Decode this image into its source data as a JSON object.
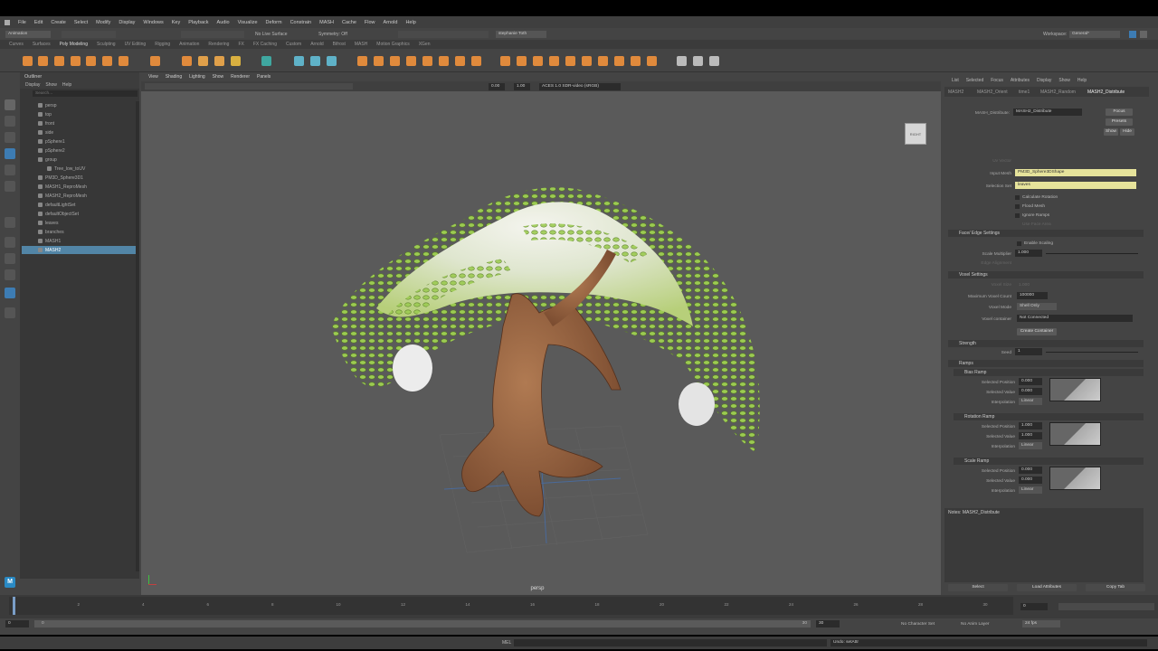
{
  "menus": [
    "File",
    "Edit",
    "Create",
    "Select",
    "Modify",
    "Display",
    "Windows",
    "Key",
    "Playback",
    "Audio",
    "Visualize",
    "Deform",
    "Constrain",
    "MASH",
    "Cache",
    "Flow",
    "Arnold",
    "Help"
  ],
  "status": {
    "mode": "Animation",
    "live_surface": "No Live Surface",
    "symmetry": "Symmetry: Off",
    "user": "stephanie Toth",
    "workspace_label": "Workspace:",
    "workspace": "General*"
  },
  "shelf_tabs": [
    "Curves",
    "Surfaces",
    "Poly Modeling",
    "Sculpting",
    "UV Editing",
    "Rigging",
    "Animation",
    "Rendering",
    "FX",
    "FX Caching",
    "Custom",
    "Arnold",
    "Bifrost",
    "MASH",
    "Motion Graphics",
    "XGen"
  ],
  "outliner": {
    "title": "Outliner",
    "menu": [
      "Display",
      "Show",
      "Help"
    ],
    "search_placeholder": "Search...",
    "items": [
      {
        "label": "persp",
        "depth": 1,
        "sel": false
      },
      {
        "label": "top",
        "depth": 1,
        "sel": false
      },
      {
        "label": "front",
        "depth": 1,
        "sel": false
      },
      {
        "label": "side",
        "depth": 1,
        "sel": false
      },
      {
        "label": "pSphere1",
        "depth": 1,
        "sel": false
      },
      {
        "label": "pSphere2",
        "depth": 1,
        "sel": false
      },
      {
        "label": "group",
        "depth": 1,
        "sel": false
      },
      {
        "label": "Tree_low_toUV",
        "depth": 2,
        "sel": false
      },
      {
        "label": "PM3D_Sphere3D1",
        "depth": 1,
        "sel": false
      },
      {
        "label": "MASH1_ReproMesh",
        "depth": 1,
        "sel": false
      },
      {
        "label": "MASH2_ReproMesh",
        "depth": 1,
        "sel": false
      },
      {
        "label": "defaultLightSet",
        "depth": 1,
        "sel": false
      },
      {
        "label": "defaultObjectSet",
        "depth": 1,
        "sel": false
      },
      {
        "label": "leaves",
        "depth": 1,
        "sel": false
      },
      {
        "label": "branches",
        "depth": 1,
        "sel": false
      },
      {
        "label": "MASH1",
        "depth": 1,
        "sel": false
      },
      {
        "label": "MASH2",
        "depth": 1,
        "sel": true
      }
    ]
  },
  "viewport": {
    "menu": [
      "View",
      "Shading",
      "Lighting",
      "Show",
      "Renderer",
      "Panels"
    ],
    "num1": "0.00",
    "num2": "1.00",
    "colorspace": "ACES 1.0 SDR-video (sRGB)",
    "camera": "persp",
    "cube_label": "RIGHT"
  },
  "attr": {
    "menu": [
      "List",
      "Selected",
      "Focus",
      "Attributes",
      "Display",
      "Show",
      "Help"
    ],
    "tabs": [
      "MASH2",
      "MASH2_Orient",
      "time1",
      "MASH2_Random",
      "MASH2_Distribute"
    ],
    "node_label": "MASH_Distribute:",
    "node_value": "MASH2_Distribute",
    "focus": "Focus",
    "presets": "Presets",
    "show": "Show",
    "hide": "Hide",
    "input_mesh_label": "Input Mesh",
    "input_mesh": "PM3D_Sphere3DShape",
    "selection_set_label": "Selection Set",
    "selection_set": "leaves",
    "uv_vector_label": "Uv Vector",
    "calc_rotation": "Calculate Rotation",
    "flood_mesh": "Flood Mesh",
    "ignore_ramps": "Ignore Ramps",
    "use_face_area": "Use Face Area",
    "face_edge": "Face/ Edge Settings",
    "enable_scaling": "Enable Scaling",
    "scale_mult_label": "Scale Multiplier",
    "scale_mult": "1.000",
    "edge_alignment_label": "Edge Alignment",
    "voxel": "Voxel Settings",
    "voxel_size_label": "Voxel Size",
    "voxel_size": "1.000",
    "max_voxel_label": "Maximum Voxel Count",
    "max_voxel": "100000",
    "voxel_mode_label": "Voxel Mode",
    "voxel_mode": "Shell Only",
    "voxel_container_label": "Voxel container",
    "voxel_container": "Not Connected",
    "create_container": "Create Container",
    "strength": "Strength",
    "seed_label": "Seed",
    "seed": "1",
    "ramps": "Ramps",
    "ramp_groups": [
      {
        "title": "Bias Ramp",
        "pos": "0.000",
        "val": "0.000",
        "interp": "Linear"
      },
      {
        "title": "Rotation Ramp",
        "pos": "1.000",
        "val": "1.000",
        "interp": "Linear"
      },
      {
        "title": "Scale Ramp",
        "pos": "0.000",
        "val": "0.000",
        "interp": "Linear"
      }
    ],
    "sel_pos_label": "Selected Position",
    "sel_val_label": "Selected Value",
    "interp_label": "Interpolation",
    "notes": "Notes: MASH2_Distribute",
    "select": "Select",
    "load": "Load Attributes",
    "copy": "Copy Tab"
  },
  "timeline": {
    "ticks": [
      "0",
      "2",
      "4",
      "6",
      "8",
      "10",
      "12",
      "14",
      "16",
      "18",
      "20",
      "22",
      "24",
      "26",
      "28",
      "30"
    ],
    "current": "0",
    "start": "0",
    "inner_start": "0",
    "inner_end": "30",
    "end": "30",
    "char_set": "No Character Set",
    "anim_layer": "No Anim Layer",
    "fps": "24 fps"
  },
  "cmdline": {
    "lang": "MEL",
    "result": "Undo: setAttr"
  },
  "colors": {
    "selection": "#5285a6",
    "highlight_field": "#e6e39b",
    "leaf_green": "#9ccb52",
    "trunk": "#8b5a3a"
  }
}
